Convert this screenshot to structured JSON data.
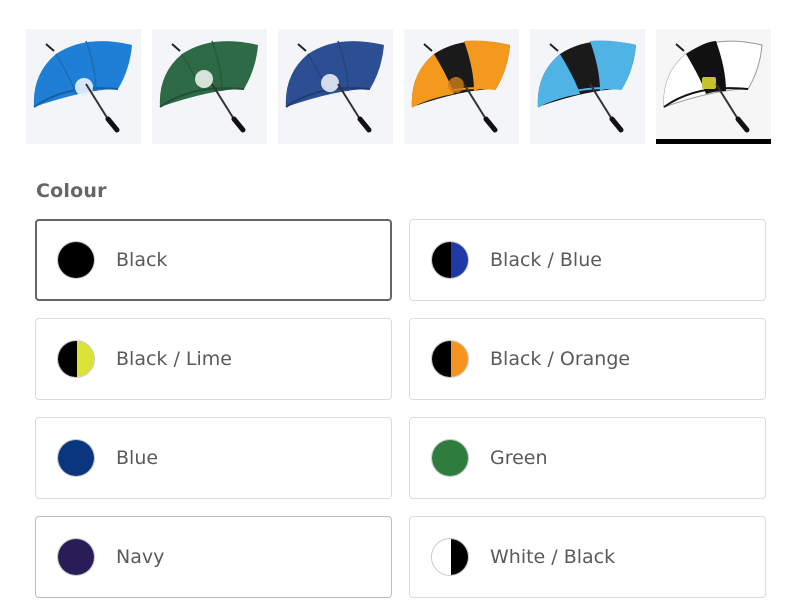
{
  "gallery": {
    "thumbnails": [
      {
        "name": "umbrella-blue",
        "canopy": "#1f7fd6",
        "trim": "#1f7fd6",
        "selected": false
      },
      {
        "name": "umbrella-green",
        "canopy": "#2f6a46",
        "trim": "#2f6a46",
        "selected": false
      },
      {
        "name": "umbrella-navy-blue",
        "canopy": "#2c4f93",
        "trim": "#2c4f93",
        "selected": false
      },
      {
        "name": "umbrella-black-orange",
        "canopy": "#1a1a1a",
        "trim": "#f39a1e",
        "selected": false
      },
      {
        "name": "umbrella-black-blue",
        "canopy": "#1a1a1a",
        "trim": "#4fb3e6",
        "selected": false
      },
      {
        "name": "umbrella-white-black",
        "canopy": "#ffffff",
        "trim": "#111111",
        "selected": true
      }
    ]
  },
  "colour": {
    "label": "Colour",
    "options": [
      {
        "label": "Black",
        "left": "#000000",
        "right": "#000000",
        "selected": true
      },
      {
        "label": "Black / Blue",
        "left": "#000000",
        "right": "#1f3aa6",
        "selected": false
      },
      {
        "label": "Black / Lime",
        "left": "#000000",
        "right": "#dbe236",
        "selected": false
      },
      {
        "label": "Black / Orange",
        "left": "#000000",
        "right": "#f5951f",
        "selected": false
      },
      {
        "label": "Blue",
        "left": "#0a3680",
        "right": "#0a3680",
        "selected": false
      },
      {
        "label": "Green",
        "left": "#2e7d3e",
        "right": "#2e7d3e",
        "selected": false
      },
      {
        "label": "Navy",
        "left": "#281d57",
        "right": "#281d57",
        "selected": false
      },
      {
        "label": "White / Black",
        "left": "#ffffff",
        "right": "#000000",
        "selected": false
      }
    ]
  }
}
